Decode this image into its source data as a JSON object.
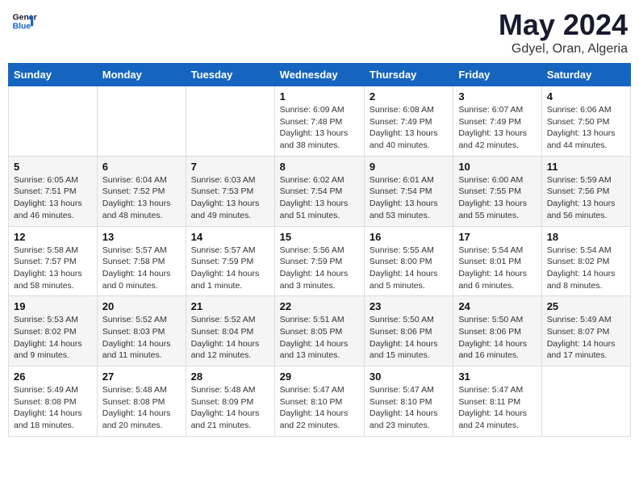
{
  "header": {
    "logo_line1": "General",
    "logo_line2": "Blue",
    "month": "May 2024",
    "location": "Gdyel, Oran, Algeria"
  },
  "weekdays": [
    "Sunday",
    "Monday",
    "Tuesday",
    "Wednesday",
    "Thursday",
    "Friday",
    "Saturday"
  ],
  "weeks": [
    [
      {
        "day": "",
        "info": ""
      },
      {
        "day": "",
        "info": ""
      },
      {
        "day": "",
        "info": ""
      },
      {
        "day": "1",
        "info": "Sunrise: 6:09 AM\nSunset: 7:48 PM\nDaylight: 13 hours\nand 38 minutes."
      },
      {
        "day": "2",
        "info": "Sunrise: 6:08 AM\nSunset: 7:49 PM\nDaylight: 13 hours\nand 40 minutes."
      },
      {
        "day": "3",
        "info": "Sunrise: 6:07 AM\nSunset: 7:49 PM\nDaylight: 13 hours\nand 42 minutes."
      },
      {
        "day": "4",
        "info": "Sunrise: 6:06 AM\nSunset: 7:50 PM\nDaylight: 13 hours\nand 44 minutes."
      }
    ],
    [
      {
        "day": "5",
        "info": "Sunrise: 6:05 AM\nSunset: 7:51 PM\nDaylight: 13 hours\nand 46 minutes."
      },
      {
        "day": "6",
        "info": "Sunrise: 6:04 AM\nSunset: 7:52 PM\nDaylight: 13 hours\nand 48 minutes."
      },
      {
        "day": "7",
        "info": "Sunrise: 6:03 AM\nSunset: 7:53 PM\nDaylight: 13 hours\nand 49 minutes."
      },
      {
        "day": "8",
        "info": "Sunrise: 6:02 AM\nSunset: 7:54 PM\nDaylight: 13 hours\nand 51 minutes."
      },
      {
        "day": "9",
        "info": "Sunrise: 6:01 AM\nSunset: 7:54 PM\nDaylight: 13 hours\nand 53 minutes."
      },
      {
        "day": "10",
        "info": "Sunrise: 6:00 AM\nSunset: 7:55 PM\nDaylight: 13 hours\nand 55 minutes."
      },
      {
        "day": "11",
        "info": "Sunrise: 5:59 AM\nSunset: 7:56 PM\nDaylight: 13 hours\nand 56 minutes."
      }
    ],
    [
      {
        "day": "12",
        "info": "Sunrise: 5:58 AM\nSunset: 7:57 PM\nDaylight: 13 hours\nand 58 minutes."
      },
      {
        "day": "13",
        "info": "Sunrise: 5:57 AM\nSunset: 7:58 PM\nDaylight: 14 hours\nand 0 minutes."
      },
      {
        "day": "14",
        "info": "Sunrise: 5:57 AM\nSunset: 7:59 PM\nDaylight: 14 hours\nand 1 minute."
      },
      {
        "day": "15",
        "info": "Sunrise: 5:56 AM\nSunset: 7:59 PM\nDaylight: 14 hours\nand 3 minutes."
      },
      {
        "day": "16",
        "info": "Sunrise: 5:55 AM\nSunset: 8:00 PM\nDaylight: 14 hours\nand 5 minutes."
      },
      {
        "day": "17",
        "info": "Sunrise: 5:54 AM\nSunset: 8:01 PM\nDaylight: 14 hours\nand 6 minutes."
      },
      {
        "day": "18",
        "info": "Sunrise: 5:54 AM\nSunset: 8:02 PM\nDaylight: 14 hours\nand 8 minutes."
      }
    ],
    [
      {
        "day": "19",
        "info": "Sunrise: 5:53 AM\nSunset: 8:02 PM\nDaylight: 14 hours\nand 9 minutes."
      },
      {
        "day": "20",
        "info": "Sunrise: 5:52 AM\nSunset: 8:03 PM\nDaylight: 14 hours\nand 11 minutes."
      },
      {
        "day": "21",
        "info": "Sunrise: 5:52 AM\nSunset: 8:04 PM\nDaylight: 14 hours\nand 12 minutes."
      },
      {
        "day": "22",
        "info": "Sunrise: 5:51 AM\nSunset: 8:05 PM\nDaylight: 14 hours\nand 13 minutes."
      },
      {
        "day": "23",
        "info": "Sunrise: 5:50 AM\nSunset: 8:06 PM\nDaylight: 14 hours\nand 15 minutes."
      },
      {
        "day": "24",
        "info": "Sunrise: 5:50 AM\nSunset: 8:06 PM\nDaylight: 14 hours\nand 16 minutes."
      },
      {
        "day": "25",
        "info": "Sunrise: 5:49 AM\nSunset: 8:07 PM\nDaylight: 14 hours\nand 17 minutes."
      }
    ],
    [
      {
        "day": "26",
        "info": "Sunrise: 5:49 AM\nSunset: 8:08 PM\nDaylight: 14 hours\nand 18 minutes."
      },
      {
        "day": "27",
        "info": "Sunrise: 5:48 AM\nSunset: 8:08 PM\nDaylight: 14 hours\nand 20 minutes."
      },
      {
        "day": "28",
        "info": "Sunrise: 5:48 AM\nSunset: 8:09 PM\nDaylight: 14 hours\nand 21 minutes."
      },
      {
        "day": "29",
        "info": "Sunrise: 5:47 AM\nSunset: 8:10 PM\nDaylight: 14 hours\nand 22 minutes."
      },
      {
        "day": "30",
        "info": "Sunrise: 5:47 AM\nSunset: 8:10 PM\nDaylight: 14 hours\nand 23 minutes."
      },
      {
        "day": "31",
        "info": "Sunrise: 5:47 AM\nSunset: 8:11 PM\nDaylight: 14 hours\nand 24 minutes."
      },
      {
        "day": "",
        "info": ""
      }
    ]
  ]
}
